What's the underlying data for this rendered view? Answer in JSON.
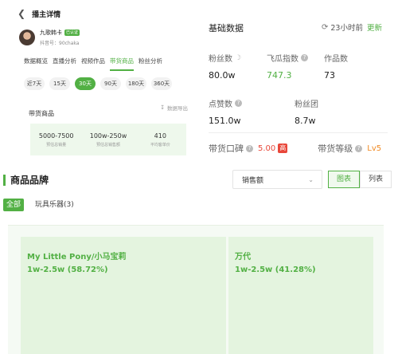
{
  "header": {
    "back_icon": "chevron-left-icon",
    "title": "播主详情"
  },
  "profile": {
    "name": "九歌韩卡",
    "tag": "已认证",
    "account_id": "抖音号：90chaka"
  },
  "nav_tabs": [
    {
      "label": "数据概览",
      "active": false
    },
    {
      "label": "直播分析",
      "active": false
    },
    {
      "label": "视频作品",
      "active": false
    },
    {
      "label": "带货商品",
      "active": true
    },
    {
      "label": "粉丝分析",
      "active": false
    }
  ],
  "day_filters": [
    {
      "label": "近7天",
      "active": false
    },
    {
      "label": "15天",
      "active": false
    },
    {
      "label": "30天",
      "active": true
    },
    {
      "label": "90天",
      "active": false
    },
    {
      "label": "180天",
      "active": false
    },
    {
      "label": "360天",
      "active": false
    }
  ],
  "goods": {
    "title": "带货商品",
    "export_label": "数据导出",
    "export_icon": "download-icon",
    "stats": [
      {
        "value": "5000-7500",
        "label": "预估总销量"
      },
      {
        "value": "100w-250w",
        "label": "预估总销售额"
      },
      {
        "value": "410",
        "label": "平均客单价"
      }
    ]
  },
  "basic": {
    "title": "基础数据",
    "refresh_icon": "refresh-icon",
    "update_time": "23小时前",
    "update_btn": "更新",
    "metrics": [
      {
        "label": "粉丝数",
        "value": "80.0w",
        "icon": "moon-icon"
      },
      {
        "label": "飞瓜指数",
        "value": "747.3",
        "icon": "help-icon"
      },
      {
        "label": "作品数",
        "value": "73",
        "icon": ""
      },
      {
        "label": "点赞数",
        "value": "151.0w",
        "icon": "help-icon"
      },
      {
        "label": "粉丝团",
        "value": "8.7w",
        "icon": ""
      }
    ],
    "reputation": {
      "label": "带货口碑",
      "score": "5.00",
      "badge": "高",
      "level_label": "带货等级",
      "level": "Lv5"
    }
  },
  "brand": {
    "title": "商品品牌",
    "select_value": "销售额",
    "view_buttons": [
      {
        "label": "图表",
        "active": true
      },
      {
        "label": "列表",
        "active": false
      }
    ],
    "filters": [
      {
        "label": "全部",
        "active": true
      },
      {
        "label": "玩具乐器(3)",
        "active": false
      }
    ],
    "chart_data": {
      "type": "treemap",
      "items": [
        {
          "name": "My Little Pony/小马宝莉",
          "value_label": "1w-2.5w (58.72%)",
          "share": 58.72
        },
        {
          "name": "万代",
          "value_label": "1w-2.5w (41.28%)",
          "share": 41.28
        }
      ]
    }
  },
  "colors": {
    "accent": "#52b044",
    "accent_light": "#e4f4df",
    "warning": "#e8473a",
    "level": "#f08a24"
  }
}
